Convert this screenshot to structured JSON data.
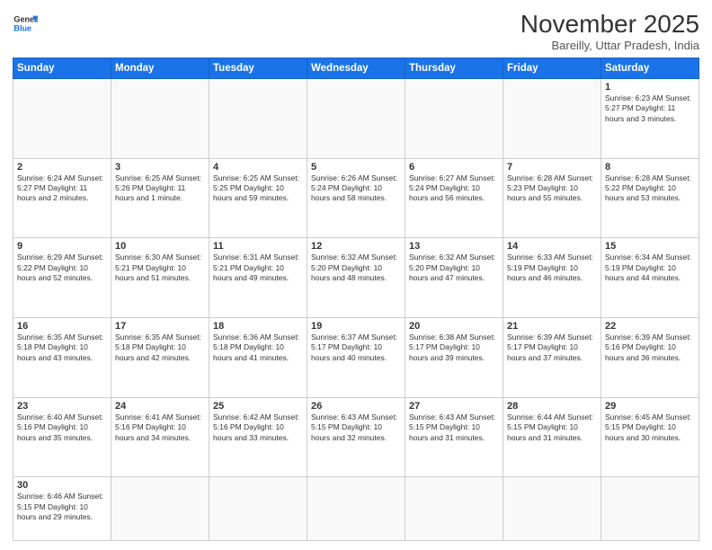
{
  "header": {
    "logo_general": "General",
    "logo_blue": "Blue",
    "month_title": "November 2025",
    "subtitle": "Bareilly, Uttar Pradesh, India"
  },
  "days_of_week": [
    "Sunday",
    "Monday",
    "Tuesday",
    "Wednesday",
    "Thursday",
    "Friday",
    "Saturday"
  ],
  "weeks": [
    [
      {
        "day": "",
        "info": ""
      },
      {
        "day": "",
        "info": ""
      },
      {
        "day": "",
        "info": ""
      },
      {
        "day": "",
        "info": ""
      },
      {
        "day": "",
        "info": ""
      },
      {
        "day": "",
        "info": ""
      },
      {
        "day": "1",
        "info": "Sunrise: 6:23 AM\nSunset: 5:27 PM\nDaylight: 11 hours and 3 minutes."
      }
    ],
    [
      {
        "day": "2",
        "info": "Sunrise: 6:24 AM\nSunset: 5:27 PM\nDaylight: 11 hours and 2 minutes."
      },
      {
        "day": "3",
        "info": "Sunrise: 6:25 AM\nSunset: 5:26 PM\nDaylight: 11 hours and 1 minute."
      },
      {
        "day": "4",
        "info": "Sunrise: 6:25 AM\nSunset: 5:25 PM\nDaylight: 10 hours and 59 minutes."
      },
      {
        "day": "5",
        "info": "Sunrise: 6:26 AM\nSunset: 5:24 PM\nDaylight: 10 hours and 58 minutes."
      },
      {
        "day": "6",
        "info": "Sunrise: 6:27 AM\nSunset: 5:24 PM\nDaylight: 10 hours and 56 minutes."
      },
      {
        "day": "7",
        "info": "Sunrise: 6:28 AM\nSunset: 5:23 PM\nDaylight: 10 hours and 55 minutes."
      },
      {
        "day": "8",
        "info": "Sunrise: 6:28 AM\nSunset: 5:22 PM\nDaylight: 10 hours and 53 minutes."
      }
    ],
    [
      {
        "day": "9",
        "info": "Sunrise: 6:29 AM\nSunset: 5:22 PM\nDaylight: 10 hours and 52 minutes."
      },
      {
        "day": "10",
        "info": "Sunrise: 6:30 AM\nSunset: 5:21 PM\nDaylight: 10 hours and 51 minutes."
      },
      {
        "day": "11",
        "info": "Sunrise: 6:31 AM\nSunset: 5:21 PM\nDaylight: 10 hours and 49 minutes."
      },
      {
        "day": "12",
        "info": "Sunrise: 6:32 AM\nSunset: 5:20 PM\nDaylight: 10 hours and 48 minutes."
      },
      {
        "day": "13",
        "info": "Sunrise: 6:32 AM\nSunset: 5:20 PM\nDaylight: 10 hours and 47 minutes."
      },
      {
        "day": "14",
        "info": "Sunrise: 6:33 AM\nSunset: 5:19 PM\nDaylight: 10 hours and 46 minutes."
      },
      {
        "day": "15",
        "info": "Sunrise: 6:34 AM\nSunset: 5:19 PM\nDaylight: 10 hours and 44 minutes."
      }
    ],
    [
      {
        "day": "16",
        "info": "Sunrise: 6:35 AM\nSunset: 5:18 PM\nDaylight: 10 hours and 43 minutes."
      },
      {
        "day": "17",
        "info": "Sunrise: 6:35 AM\nSunset: 5:18 PM\nDaylight: 10 hours and 42 minutes."
      },
      {
        "day": "18",
        "info": "Sunrise: 6:36 AM\nSunset: 5:18 PM\nDaylight: 10 hours and 41 minutes."
      },
      {
        "day": "19",
        "info": "Sunrise: 6:37 AM\nSunset: 5:17 PM\nDaylight: 10 hours and 40 minutes."
      },
      {
        "day": "20",
        "info": "Sunrise: 6:38 AM\nSunset: 5:17 PM\nDaylight: 10 hours and 39 minutes."
      },
      {
        "day": "21",
        "info": "Sunrise: 6:39 AM\nSunset: 5:17 PM\nDaylight: 10 hours and 37 minutes."
      },
      {
        "day": "22",
        "info": "Sunrise: 6:39 AM\nSunset: 5:16 PM\nDaylight: 10 hours and 36 minutes."
      }
    ],
    [
      {
        "day": "23",
        "info": "Sunrise: 6:40 AM\nSunset: 5:16 PM\nDaylight: 10 hours and 35 minutes."
      },
      {
        "day": "24",
        "info": "Sunrise: 6:41 AM\nSunset: 5:16 PM\nDaylight: 10 hours and 34 minutes."
      },
      {
        "day": "25",
        "info": "Sunrise: 6:42 AM\nSunset: 5:16 PM\nDaylight: 10 hours and 33 minutes."
      },
      {
        "day": "26",
        "info": "Sunrise: 6:43 AM\nSunset: 5:15 PM\nDaylight: 10 hours and 32 minutes."
      },
      {
        "day": "27",
        "info": "Sunrise: 6:43 AM\nSunset: 5:15 PM\nDaylight: 10 hours and 31 minutes."
      },
      {
        "day": "28",
        "info": "Sunrise: 6:44 AM\nSunset: 5:15 PM\nDaylight: 10 hours and 31 minutes."
      },
      {
        "day": "29",
        "info": "Sunrise: 6:45 AM\nSunset: 5:15 PM\nDaylight: 10 hours and 30 minutes."
      }
    ],
    [
      {
        "day": "30",
        "info": "Sunrise: 6:46 AM\nSunset: 5:15 PM\nDaylight: 10 hours and 29 minutes."
      },
      {
        "day": "",
        "info": ""
      },
      {
        "day": "",
        "info": ""
      },
      {
        "day": "",
        "info": ""
      },
      {
        "day": "",
        "info": ""
      },
      {
        "day": "",
        "info": ""
      },
      {
        "day": "",
        "info": ""
      }
    ]
  ]
}
